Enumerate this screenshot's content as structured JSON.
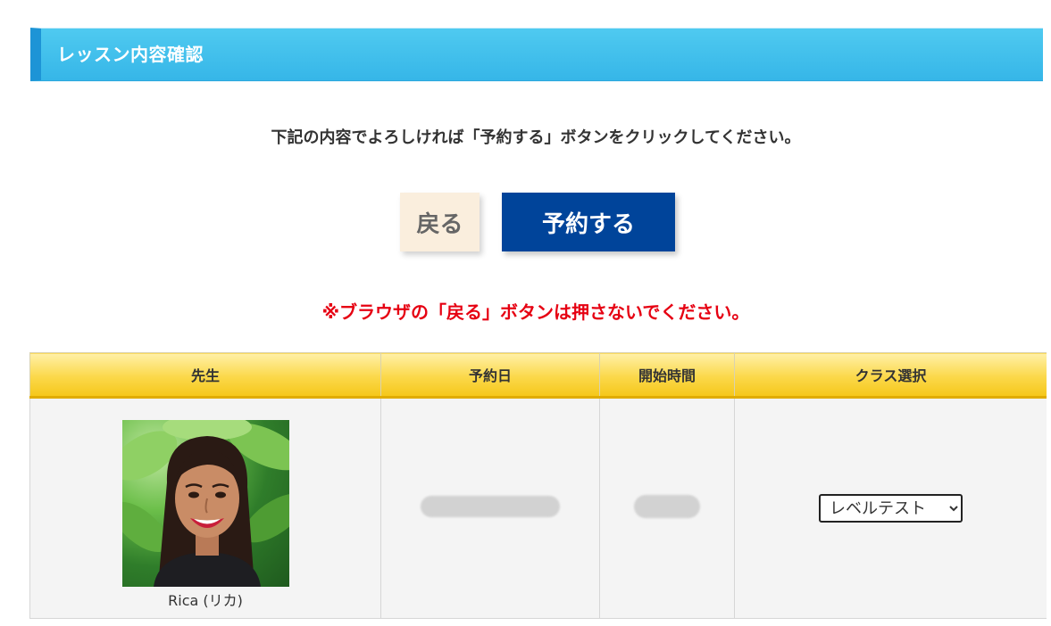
{
  "header": {
    "title": "レッスン内容確認"
  },
  "instruction": "下記の内容でよろしければ「予約する」ボタンをクリックしてください。",
  "buttons": {
    "back_label": "戻る",
    "reserve_label": "予約する"
  },
  "warning": "※ブラウザの「戻る」ボタンは押さないでください。",
  "table": {
    "headers": [
      "先生",
      "予約日",
      "開始時間",
      "クラス選択"
    ],
    "row": {
      "teacher_name": "Rica (リカ)",
      "class_selected": "レベルテスト",
      "class_options": [
        "レベルテスト"
      ]
    }
  },
  "colors": {
    "header_bar": "#3cbcec",
    "reserve_button": "#00449a",
    "back_button": "#faeedd",
    "warning_text": "#e60012",
    "table_header": "#fbd84a"
  }
}
